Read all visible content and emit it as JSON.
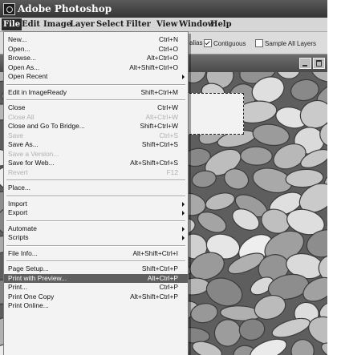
{
  "window": {
    "title": "Adobe Photoshop"
  },
  "menubar": {
    "items": [
      "File",
      "Edit",
      "Image",
      "Layer",
      "Select",
      "Filter",
      "View",
      "Window",
      "Help"
    ]
  },
  "options_bar": {
    "anti_alias_label": "alias",
    "contiguous_label": "Contiguous",
    "contiguous_checked": true,
    "sample_all_layers_label": "Sample All Layers",
    "sample_all_layers_checked": false
  },
  "file_menu": {
    "items": [
      {
        "label": "New...",
        "shortcut": "Ctrl+N"
      },
      {
        "label": "Open...",
        "shortcut": "Ctrl+O"
      },
      {
        "label": "Browse...",
        "shortcut": "Alt+Ctrl+O"
      },
      {
        "label": "Open As...",
        "shortcut": "Alt+Shift+Ctrl+O"
      },
      {
        "label": "Open Recent",
        "shortcut": "",
        "submenu": true
      },
      {
        "label": "Edit in ImageReady",
        "shortcut": "Shift+Ctrl+M"
      },
      {
        "label": "Close",
        "shortcut": "Ctrl+W"
      },
      {
        "label": "Close All",
        "shortcut": "Alt+Ctrl+W",
        "disabled": true
      },
      {
        "label": "Close and Go To Bridge...",
        "shortcut": "Shift+Ctrl+W"
      },
      {
        "label": "Save",
        "shortcut": "Ctrl+S",
        "disabled": true
      },
      {
        "label": "Save As...",
        "shortcut": "Shift+Ctrl+S"
      },
      {
        "label": "Save a Version...",
        "shortcut": "",
        "disabled": true
      },
      {
        "label": "Save for Web...",
        "shortcut": "Alt+Shift+Ctrl+S"
      },
      {
        "label": "Revert",
        "shortcut": "F12",
        "disabled": true
      },
      {
        "label": "Place...",
        "shortcut": ""
      },
      {
        "label": "Import",
        "shortcut": "",
        "submenu": true
      },
      {
        "label": "Export",
        "shortcut": "",
        "submenu": true
      },
      {
        "label": "Automate",
        "shortcut": "",
        "submenu": true
      },
      {
        "label": "Scripts",
        "shortcut": "",
        "submenu": true
      },
      {
        "label": "File Info...",
        "shortcut": "Alt+Shift+Ctrl+I"
      },
      {
        "label": "Page Setup...",
        "shortcut": "Shift+Ctrl+P"
      },
      {
        "label": "Print with Preview...",
        "shortcut": "Alt+Ctrl+P",
        "highlighted": true
      },
      {
        "label": "Print...",
        "shortcut": "Ctrl+P"
      },
      {
        "label": "Print One Copy",
        "shortcut": "Alt+Shift+Ctrl+P"
      },
      {
        "label": "Print Online...",
        "shortcut": ""
      }
    ]
  }
}
